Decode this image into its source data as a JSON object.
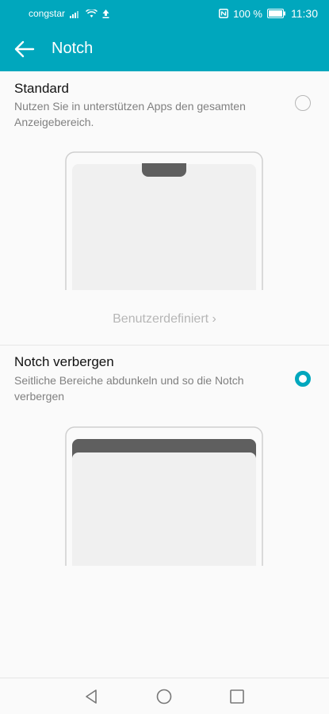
{
  "statusbar": {
    "carrier": "congstar",
    "battery": "100 %",
    "time": "11:30"
  },
  "appbar": {
    "title": "Notch"
  },
  "options": [
    {
      "title": "Standard",
      "description": "Nutzen Sie in unterstützen Apps den gesamten Anzeigebereich.",
      "selected": false
    },
    {
      "title": "Notch verbergen",
      "description": "Seitliche Bereiche abdunkeln und so die Notch verbergen",
      "selected": true
    }
  ],
  "custom_link": "Benutzerdefiniert ›",
  "colors": {
    "accent": "#00a7bd",
    "background": "#fafafa",
    "notch": "#5f5f5f"
  },
  "icons": {
    "back": "arrow-left-icon",
    "signal": "signal-icon",
    "wifi": "wifi-icon",
    "upload": "upload-icon",
    "nfc": "nfc-icon",
    "battery": "battery-icon",
    "nav_back": "triangle-back-icon",
    "nav_home": "circle-home-icon",
    "nav_recents": "square-recents-icon"
  }
}
